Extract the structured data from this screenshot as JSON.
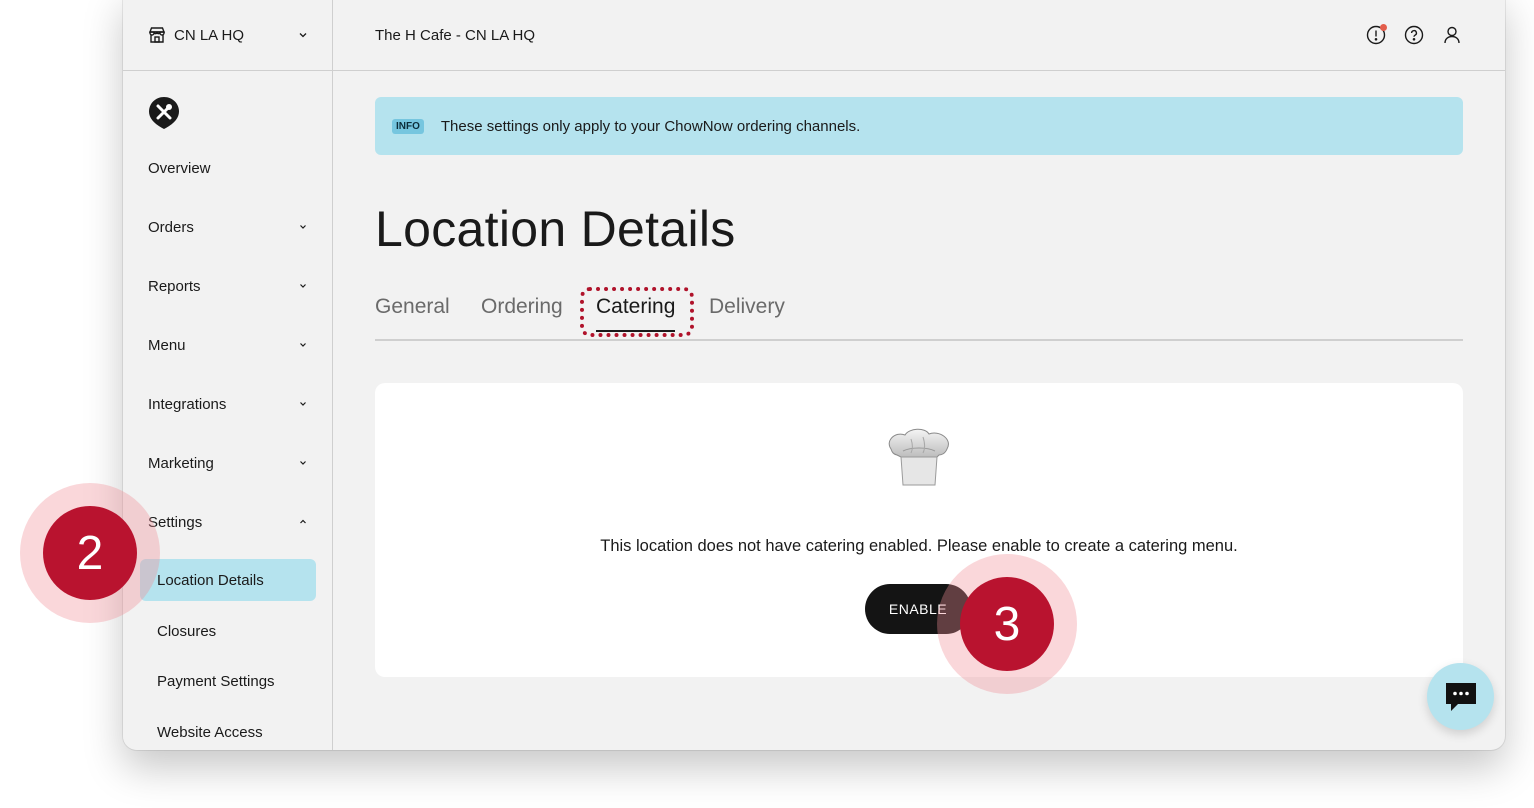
{
  "location_selector": {
    "label": "CN LA HQ"
  },
  "header": {
    "title": "The H Cafe - CN LA HQ"
  },
  "sidebar": {
    "items": [
      {
        "label": "Overview"
      },
      {
        "label": "Orders"
      },
      {
        "label": "Reports"
      },
      {
        "label": "Menu"
      },
      {
        "label": "Integrations"
      },
      {
        "label": "Marketing"
      },
      {
        "label": "Settings"
      }
    ],
    "settings_subitems": [
      {
        "label": "Location Details",
        "active": true
      },
      {
        "label": "Closures"
      },
      {
        "label": "Payment Settings"
      },
      {
        "label": "Website Access"
      }
    ]
  },
  "info_banner": {
    "badge": "INFO",
    "text": "These settings only apply to your ChowNow ordering channels."
  },
  "page": {
    "title": "Location Details"
  },
  "tabs": [
    {
      "label": "General"
    },
    {
      "label": "Ordering"
    },
    {
      "label": "Catering",
      "active": true
    },
    {
      "label": "Delivery"
    }
  ],
  "catering_card": {
    "message": "This location does not have catering enabled. Please enable to create a catering menu.",
    "enable_label": "ENABLE"
  },
  "step_markers": {
    "step2": "2",
    "step3": "3"
  },
  "colors": {
    "accent_info": "#b5e3ee",
    "step_marker": "#b9132f",
    "button_dark": "#141414"
  }
}
